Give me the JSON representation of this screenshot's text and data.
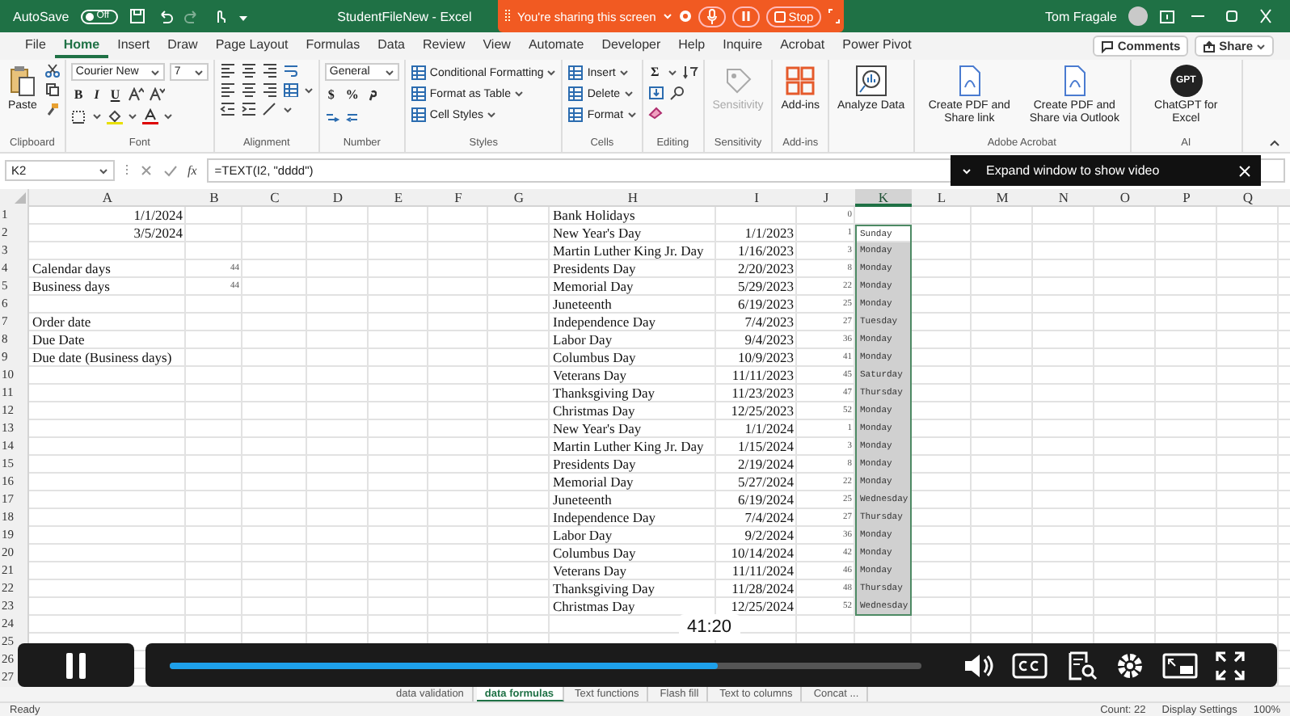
{
  "title_bar": {
    "autosave_label": "AutoSave",
    "autosave": {
      "on": false,
      "label": "Off"
    },
    "document_title": "StudentFileNew  -  Excel",
    "user": "Tom Fragale"
  },
  "sharing_banner": {
    "message": "You're sharing this screen",
    "stop": "Stop"
  },
  "ribbon": {
    "tabs": [
      {
        "label": "File",
        "selected": false
      },
      {
        "label": "Home",
        "selected": true
      },
      {
        "label": "Insert",
        "selected": false
      },
      {
        "label": "Draw",
        "selected": false
      },
      {
        "label": "Page Layout",
        "selected": false
      },
      {
        "label": "Formulas",
        "selected": false
      },
      {
        "label": "Data",
        "selected": false
      },
      {
        "label": "Review",
        "selected": false
      },
      {
        "label": "View",
        "selected": false
      },
      {
        "label": "Automate",
        "selected": false
      },
      {
        "label": "Developer",
        "selected": false
      },
      {
        "label": "Help",
        "selected": false
      },
      {
        "label": "Inquire",
        "selected": false
      },
      {
        "label": "Acrobat",
        "selected": false
      },
      {
        "label": "Power Pivot",
        "selected": false
      }
    ],
    "comments": "Comments",
    "share": "Share",
    "groups": [
      {
        "kind": "clipboard",
        "label": "Clipboard",
        "items": [
          {
            "label": "Paste"
          }
        ]
      },
      {
        "kind": "font",
        "label": "Font",
        "font": "Courier New",
        "size": "7",
        "buttons": [
          "B",
          "I",
          "U"
        ]
      },
      {
        "kind": "alignment",
        "label": "Alignment"
      },
      {
        "kind": "number",
        "label": "Number",
        "format": "General",
        "buttons": [
          "$",
          "%"
        ]
      },
      {
        "kind": "list",
        "label": "Styles",
        "items": [
          {
            "label": "Conditional Formatting"
          },
          {
            "label": "Format as Table"
          },
          {
            "label": "Cell Styles"
          }
        ]
      },
      {
        "kind": "list",
        "label": "Cells",
        "items": [
          {
            "label": "Insert"
          },
          {
            "label": "Delete"
          },
          {
            "label": "Format"
          }
        ]
      },
      {
        "kind": "editing",
        "label": "Editing",
        "buttons": [
          "Σ"
        ]
      },
      {
        "kind": "sensitivity",
        "label": "Sensitivity",
        "items": [
          {
            "label": "Sensitivity",
            "disabled": true
          }
        ]
      },
      {
        "kind": "addins",
        "label": "Add-ins",
        "items": [
          {
            "label": "Add-ins",
            "disabled": false
          }
        ]
      },
      {
        "kind": "analyze",
        "items": [
          {
            "label": "Analyze Data",
            "disabled": false
          }
        ]
      },
      {
        "kind": "acrobat",
        "label": "Adobe Acrobat",
        "items": [
          {
            "label": "Create PDF and Share link",
            "disabled": false
          },
          {
            "label": "Create PDF and Share via Outlook",
            "disabled": false
          }
        ]
      },
      {
        "kind": "ai",
        "label": "AI",
        "items": [
          {
            "label": "ChatGPT for Excel",
            "logo": "GPT",
            "disabled": false
          }
        ]
      }
    ]
  },
  "formula_bar": {
    "name_box": "K2",
    "function_label": "fx",
    "formula": "=TEXT(I2, \"dddd\")"
  },
  "video_popup": {
    "message": "Expand window to show video"
  },
  "sheet": {
    "columns": [
      {
        "label": "A",
        "selected": false
      },
      {
        "label": "B",
        "selected": false
      },
      {
        "label": "C",
        "selected": false
      },
      {
        "label": "D",
        "selected": false
      },
      {
        "label": "E",
        "selected": false
      },
      {
        "label": "F",
        "selected": false
      },
      {
        "label": "G",
        "selected": false
      },
      {
        "label": "H",
        "selected": false
      },
      {
        "label": "I",
        "selected": false
      },
      {
        "label": "J",
        "selected": false
      },
      {
        "label": "K",
        "selected": true
      },
      {
        "label": "L",
        "selected": false
      },
      {
        "label": "M",
        "selected": false
      },
      {
        "label": "N",
        "selected": false
      },
      {
        "label": "O",
        "selected": false
      },
      {
        "label": "P",
        "selected": false
      },
      {
        "label": "Q",
        "selected": false
      }
    ],
    "rows": [
      {
        "number": "1",
        "cells": {
          "A": {
            "kind": "date",
            "text": "1/1/2024"
          },
          "H": {
            "kind": "text",
            "text": "Bank Holidays"
          },
          "J": {
            "kind": "number",
            "text": "0"
          }
        }
      },
      {
        "number": "2",
        "cells": {
          "A": {
            "kind": "date",
            "text": "3/5/2024"
          },
          "H": {
            "kind": "text",
            "text": "New Year's Day"
          },
          "I": {
            "kind": "date",
            "text": "1/1/2023"
          },
          "J": {
            "kind": "number",
            "text": "1"
          },
          "K": {
            "kind": "day",
            "text": "Sunday",
            "selected": false
          }
        }
      },
      {
        "number": "3",
        "cells": {
          "H": {
            "kind": "text",
            "text": "Martin Luther King Jr. Day"
          },
          "I": {
            "kind": "date",
            "text": "1/16/2023"
          },
          "J": {
            "kind": "number",
            "text": "3"
          },
          "K": {
            "kind": "day",
            "text": "Monday",
            "selected": true
          }
        }
      },
      {
        "number": "4",
        "cells": {
          "A": {
            "kind": "text",
            "text": "Calendar days"
          },
          "B": {
            "kind": "number",
            "text": "44"
          },
          "H": {
            "kind": "text",
            "text": "Presidents Day"
          },
          "I": {
            "kind": "date",
            "text": "2/20/2023"
          },
          "J": {
            "kind": "number",
            "text": "8"
          },
          "K": {
            "kind": "day",
            "text": "Monday",
            "selected": true
          }
        }
      },
      {
        "number": "5",
        "cells": {
          "A": {
            "kind": "text",
            "text": "Business days"
          },
          "B": {
            "kind": "number",
            "text": "44"
          },
          "H": {
            "kind": "text",
            "text": "Memorial Day"
          },
          "I": {
            "kind": "date",
            "text": "5/29/2023"
          },
          "J": {
            "kind": "number",
            "text": "22"
          },
          "K": {
            "kind": "day",
            "text": "Monday",
            "selected": true
          }
        }
      },
      {
        "number": "6",
        "cells": {
          "H": {
            "kind": "text",
            "text": "Juneteenth"
          },
          "I": {
            "kind": "date",
            "text": "6/19/2023"
          },
          "J": {
            "kind": "number",
            "text": "25"
          },
          "K": {
            "kind": "day",
            "text": "Monday",
            "selected": true
          }
        }
      },
      {
        "number": "7",
        "cells": {
          "A": {
            "kind": "text",
            "text": "Order date"
          },
          "H": {
            "kind": "text",
            "text": "Independence Day"
          },
          "I": {
            "kind": "date",
            "text": "7/4/2023"
          },
          "J": {
            "kind": "number",
            "text": "27"
          },
          "K": {
            "kind": "day",
            "text": "Tuesday",
            "selected": true
          }
        }
      },
      {
        "number": "8",
        "cells": {
          "A": {
            "kind": "text",
            "text": "Due Date"
          },
          "H": {
            "kind": "text",
            "text": "Labor Day"
          },
          "I": {
            "kind": "date",
            "text": "9/4/2023"
          },
          "J": {
            "kind": "number",
            "text": "36"
          },
          "K": {
            "kind": "day",
            "text": "Monday",
            "selected": true
          }
        }
      },
      {
        "number": "9",
        "cells": {
          "A": {
            "kind": "text",
            "text": "Due date (Business days)"
          },
          "H": {
            "kind": "text",
            "text": "Columbus Day"
          },
          "I": {
            "kind": "date",
            "text": "10/9/2023"
          },
          "J": {
            "kind": "number",
            "text": "41"
          },
          "K": {
            "kind": "day",
            "text": "Monday",
            "selected": true
          }
        }
      },
      {
        "number": "10",
        "cells": {
          "H": {
            "kind": "text",
            "text": "Veterans Day"
          },
          "I": {
            "kind": "date",
            "text": "11/11/2023"
          },
          "J": {
            "kind": "number",
            "text": "45"
          },
          "K": {
            "kind": "day",
            "text": "Saturday",
            "selected": true
          }
        }
      },
      {
        "number": "11",
        "cells": {
          "H": {
            "kind": "text",
            "text": "Thanksgiving Day"
          },
          "I": {
            "kind": "date",
            "text": "11/23/2023"
          },
          "J": {
            "kind": "number",
            "text": "47"
          },
          "K": {
            "kind": "day",
            "text": "Thursday",
            "selected": true
          }
        }
      },
      {
        "number": "12",
        "cells": {
          "H": {
            "kind": "text",
            "text": "Christmas Day"
          },
          "I": {
            "kind": "date",
            "text": "12/25/2023"
          },
          "J": {
            "kind": "number",
            "text": "52"
          },
          "K": {
            "kind": "day",
            "text": "Monday",
            "selected": true
          }
        }
      },
      {
        "number": "13",
        "cells": {
          "H": {
            "kind": "text",
            "text": "New Year's Day"
          },
          "I": {
            "kind": "date",
            "text": "1/1/2024"
          },
          "J": {
            "kind": "number",
            "text": "1"
          },
          "K": {
            "kind": "day",
            "text": "Monday",
            "selected": true
          }
        }
      },
      {
        "number": "14",
        "cells": {
          "H": {
            "kind": "text",
            "text": "Martin Luther King Jr. Day"
          },
          "I": {
            "kind": "date",
            "text": "1/15/2024"
          },
          "J": {
            "kind": "number",
            "text": "3"
          },
          "K": {
            "kind": "day",
            "text": "Monday",
            "selected": true
          }
        }
      },
      {
        "number": "15",
        "cells": {
          "H": {
            "kind": "text",
            "text": "Presidents Day"
          },
          "I": {
            "kind": "date",
            "text": "2/19/2024"
          },
          "J": {
            "kind": "number",
            "text": "8"
          },
          "K": {
            "kind": "day",
            "text": "Monday",
            "selected": true
          }
        }
      },
      {
        "number": "16",
        "cells": {
          "H": {
            "kind": "text",
            "text": "Memorial Day"
          },
          "I": {
            "kind": "date",
            "text": "5/27/2024"
          },
          "J": {
            "kind": "number",
            "text": "22"
          },
          "K": {
            "kind": "day",
            "text": "Monday",
            "selected": true
          }
        }
      },
      {
        "number": "17",
        "cells": {
          "H": {
            "kind": "text",
            "text": "Juneteenth"
          },
          "I": {
            "kind": "date",
            "text": "6/19/2024"
          },
          "J": {
            "kind": "number",
            "text": "25"
          },
          "K": {
            "kind": "day",
            "text": "Wednesday",
            "selected": true
          }
        }
      },
      {
        "number": "18",
        "cells": {
          "H": {
            "kind": "text",
            "text": "Independence Day"
          },
          "I": {
            "kind": "date",
            "text": "7/4/2024"
          },
          "J": {
            "kind": "number",
            "text": "27"
          },
          "K": {
            "kind": "day",
            "text": "Thursday",
            "selected": true
          }
        }
      },
      {
        "number": "19",
        "cells": {
          "H": {
            "kind": "text",
            "text": "Labor Day"
          },
          "I": {
            "kind": "date",
            "text": "9/2/2024"
          },
          "J": {
            "kind": "number",
            "text": "36"
          },
          "K": {
            "kind": "day",
            "text": "Monday",
            "selected": true
          }
        }
      },
      {
        "number": "20",
        "cells": {
          "H": {
            "kind": "text",
            "text": "Columbus Day"
          },
          "I": {
            "kind": "date",
            "text": "10/14/2024"
          },
          "J": {
            "kind": "number",
            "text": "42"
          },
          "K": {
            "kind": "day",
            "text": "Monday",
            "selected": true
          }
        }
      },
      {
        "number": "21",
        "cells": {
          "H": {
            "kind": "text",
            "text": "Veterans Day"
          },
          "I": {
            "kind": "date",
            "text": "11/11/2024"
          },
          "J": {
            "kind": "number",
            "text": "46"
          },
          "K": {
            "kind": "day",
            "text": "Monday",
            "selected": true
          }
        }
      },
      {
        "number": "22",
        "cells": {
          "H": {
            "kind": "text",
            "text": "Thanksgiving Day"
          },
          "I": {
            "kind": "date",
            "text": "11/28/2024"
          },
          "J": {
            "kind": "number",
            "text": "48"
          },
          "K": {
            "kind": "day",
            "text": "Thursday",
            "selected": true
          }
        }
      },
      {
        "number": "23",
        "cells": {
          "H": {
            "kind": "text",
            "text": "Christmas Day"
          },
          "I": {
            "kind": "date",
            "text": "12/25/2024"
          },
          "J": {
            "kind": "number",
            "text": "52"
          },
          "K": {
            "kind": "day",
            "text": "Wednesday",
            "selected": true
          }
        }
      },
      {
        "number": "24"
      },
      {
        "number": "25"
      },
      {
        "number": "26"
      },
      {
        "number": "27"
      }
    ]
  },
  "video": {
    "playing": true,
    "time": "41:20",
    "level": 0.73
  },
  "sheet_tabs": [
    {
      "label": "data validation",
      "selected": false
    },
    {
      "label": "data formulas",
      "selected": true
    },
    {
      "label": "Text functions",
      "selected": false
    },
    {
      "label": "Flash fill",
      "selected": false
    },
    {
      "label": "Text to columns",
      "selected": false
    },
    {
      "label": "Concat ...",
      "selected": false
    }
  ],
  "status_bar": {
    "mode": "Ready",
    "count": "Count: 22",
    "display_settings": "Display Settings",
    "zoom": "100%"
  }
}
